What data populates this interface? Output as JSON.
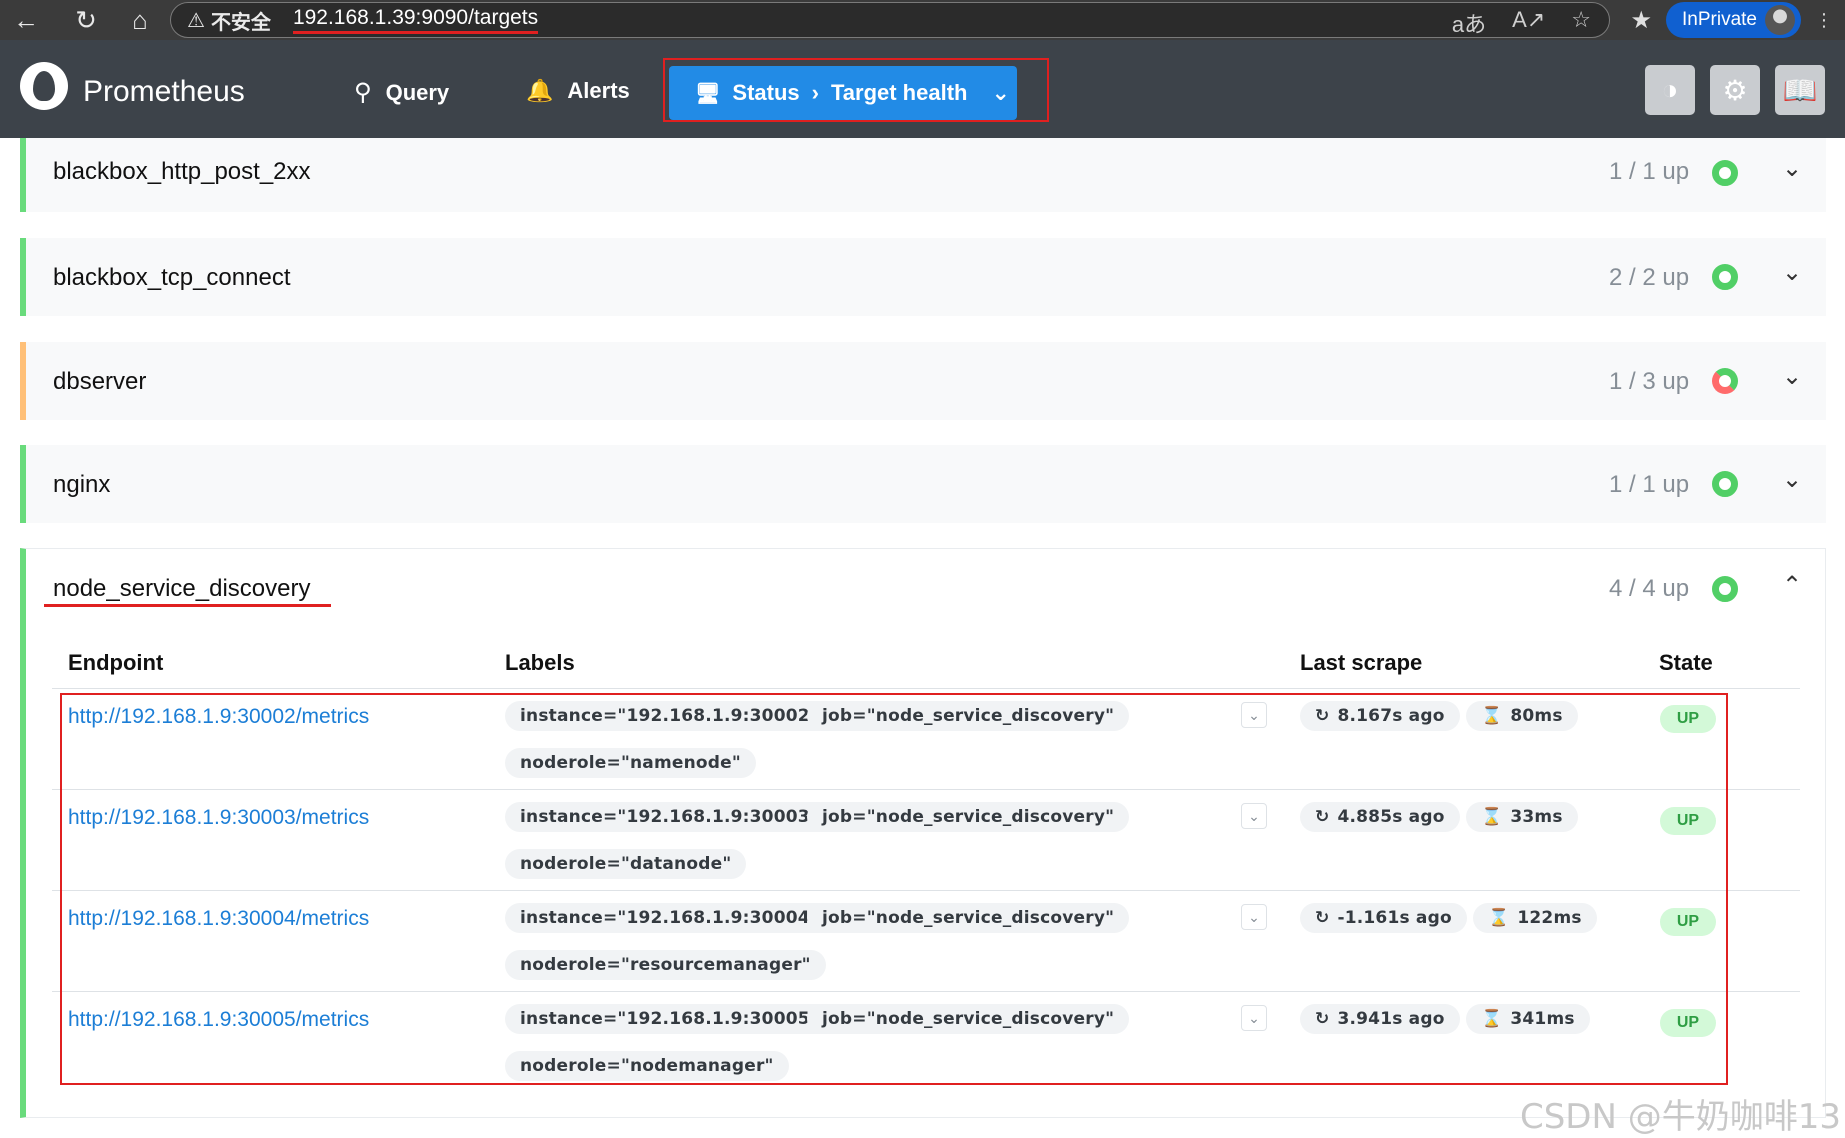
{
  "browser": {
    "security_label": "不安全",
    "url": "192.168.1.39:9090/targets",
    "inprivate_label": "InPrivate"
  },
  "header": {
    "brand": "Prometheus",
    "nav": {
      "query": "Query",
      "alerts": "Alerts",
      "status": "Status",
      "status_sep": "›",
      "target_health": "Target health"
    }
  },
  "jobs": [
    {
      "name": "blackbox_http_post_2xx",
      "count": "1 / 1 up",
      "health": "all-up"
    },
    {
      "name": "blackbox_tcp_connect",
      "count": "2 / 2 up",
      "health": "all-up"
    },
    {
      "name": "dbserver",
      "count": "1 / 3 up",
      "health": "partial"
    },
    {
      "name": "nginx",
      "count": "1 / 1 up",
      "health": "all-up"
    },
    {
      "name": "node_service_discovery",
      "count": "4 / 4 up",
      "health": "all-up",
      "expanded": true
    }
  ],
  "table": {
    "headers": {
      "endpoint": "Endpoint",
      "labels": "Labels",
      "last_scrape": "Last scrape",
      "state": "State"
    },
    "rows": [
      {
        "endpoint": "http://192.168.1.9:30002/metrics",
        "instance": "instance=\"192.168.1.9:30002\"",
        "job": "job=\"node_service_discovery\"",
        "noderole": "noderole=\"namenode\"",
        "scrape_ago": "8.167s ago",
        "duration": "80ms",
        "state": "UP"
      },
      {
        "endpoint": "http://192.168.1.9:30003/metrics",
        "instance": "instance=\"192.168.1.9:30003\"",
        "job": "job=\"node_service_discovery\"",
        "noderole": "noderole=\"datanode\"",
        "scrape_ago": "4.885s ago",
        "duration": "33ms",
        "state": "UP"
      },
      {
        "endpoint": "http://192.168.1.9:30004/metrics",
        "instance": "instance=\"192.168.1.9:30004\"",
        "job": "job=\"node_service_discovery\"",
        "noderole": "noderole=\"resourcemanager\"",
        "scrape_ago": "-1.161s ago",
        "duration": "122ms",
        "state": "UP"
      },
      {
        "endpoint": "http://192.168.1.9:30005/metrics",
        "instance": "instance=\"192.168.1.9:30005\"",
        "job": "job=\"node_service_discovery\"",
        "noderole": "noderole=\"nodemanager\"",
        "scrape_ago": "3.941s ago",
        "duration": "341ms",
        "state": "UP"
      }
    ]
  },
  "watermark": "CSDN @牛奶咖啡13",
  "colors": {
    "accent": "#228be6",
    "up_green": "#51cf66",
    "down_red": "#ff6b6b",
    "warn_orange": "#ffc078",
    "highlight_red": "#e02020"
  }
}
